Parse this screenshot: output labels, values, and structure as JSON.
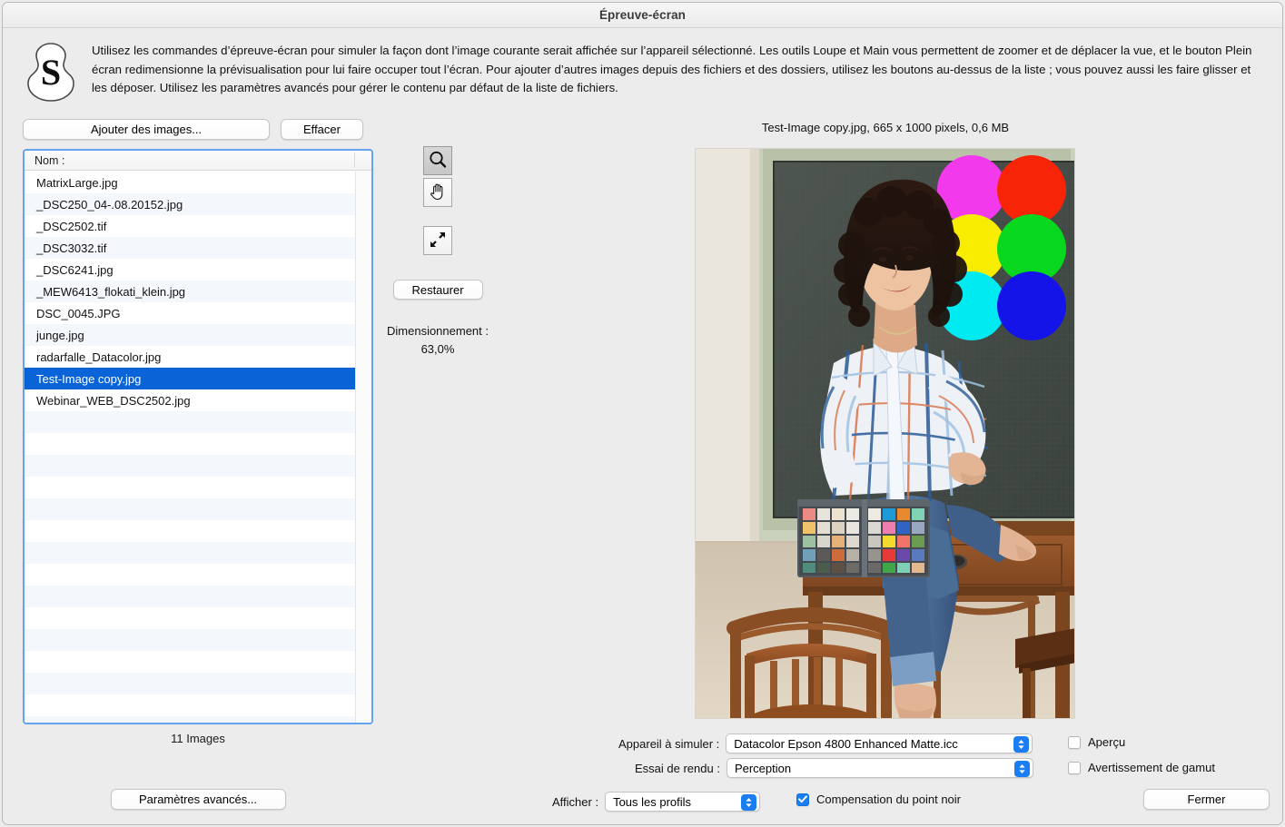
{
  "window": {
    "title": "Épreuve-écran"
  },
  "header": {
    "logo_letter": "S",
    "description": "Utilisez les commandes d’épreuve-écran pour simuler la façon dont l’image courante serait affichée sur l’appareil sélectionné. Les outils Loupe et Main vous permettent de zoomer et de déplacer la vue, et le bouton Plein écran redimensionne la prévisualisation pour lui faire occuper tout l’écran. Pour ajouter d’autres images depuis des fichiers et des dossiers, utilisez les boutons au-dessus de la liste ; vous pouvez aussi les faire glisser et les déposer. Utilisez les paramètres avancés pour gérer le contenu par défaut de la liste de fichiers."
  },
  "toolbar": {
    "add_images_label": "Ajouter des images...",
    "clear_label": "Effacer"
  },
  "file_list": {
    "column_header": "Nom :",
    "items": [
      "MatrixLarge.jpg",
      "_DSC250_04-.08.20152.jpg",
      "_DSC2502.tif",
      "_DSC3032.tif",
      "_DSC6241.jpg",
      "_MEW6413_flokati_klein.jpg",
      "DSC_0045.JPG",
      "junge.jpg",
      "radarfalle_Datacolor.jpg",
      "Test-Image copy.jpg",
      "Webinar_WEB_DSC2502.jpg"
    ],
    "selected_index": 9,
    "empty_rows": 15,
    "count_label": "11 Images",
    "selection_color": "#0a64d8",
    "stripe_color": "#f4f7fb",
    "focus_border_color": "#66a3ee"
  },
  "advanced": {
    "label": "Paramètres avancés..."
  },
  "tools": {
    "zoom_tool": "loupe-icon",
    "hand_tool": "hand-icon",
    "fullscreen_tool": "fullscreen-icon",
    "active_tool": "loupe",
    "restore_label": "Restaurer",
    "scaling_label": "Dimensionnement :",
    "scaling_value": "63,0%"
  },
  "preview": {
    "info": "Test-Image copy.jpg, 665 x 1000 pixels, 0,6 MB",
    "image_alt": "Femme assise sur une table tenant une mire ColorChecker, avec six pastilles de couleur",
    "swatch_circles": [
      {
        "name": "magenta",
        "color": "#f23aec"
      },
      {
        "name": "red",
        "color": "#f72408"
      },
      {
        "name": "yellow",
        "color": "#f8ec00"
      },
      {
        "name": "green",
        "color": "#07d81e"
      },
      {
        "name": "cyan",
        "color": "#00eaf2"
      },
      {
        "name": "blue",
        "color": "#1414e8"
      }
    ]
  },
  "settings": {
    "device_label": "Appareil à simuler :",
    "device_value": "Datacolor Epson 4800 Enhanced Matte.icc",
    "intent_label": "Essai de rendu :",
    "intent_value": "Perception",
    "display_label": "Afficher :",
    "display_value": "Tous les profils",
    "preview_checkbox_label": "Aperçu",
    "preview_checked": false,
    "gamut_checkbox_label": "Avertissement de gamut",
    "gamut_checked": false,
    "blackpoint_checkbox_label": "Compensation du point noir",
    "blackpoint_checked": true,
    "accent_color": "#1a7ef2"
  },
  "footer": {
    "close_label": "Fermer"
  }
}
